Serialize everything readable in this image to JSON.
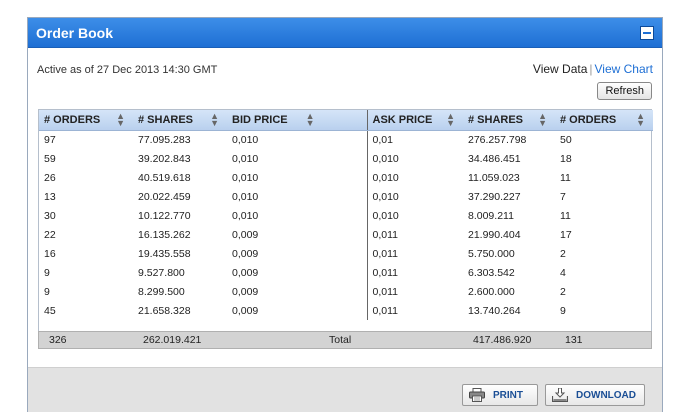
{
  "panel": {
    "title": "Order Book"
  },
  "status": "Active as of 27 Dec 2013 14:30 GMT",
  "view_links": {
    "data": "View Data",
    "separator": "|",
    "chart": "View Chart"
  },
  "refresh_label": "Refresh",
  "columns": [
    "# ORDERS",
    "# SHARES",
    "BID PRICE",
    "ASK PRICE",
    "# SHARES",
    "# ORDERS"
  ],
  "rows": [
    [
      "97",
      "77.095.283",
      "0,010",
      "0,01",
      "276.257.798",
      "50"
    ],
    [
      "59",
      "39.202.843",
      "0,010",
      "0,010",
      "34.486.451",
      "18"
    ],
    [
      "26",
      "40.519.618",
      "0,010",
      "0,010",
      "11.059.023",
      "11"
    ],
    [
      "13",
      "20.022.459",
      "0,010",
      "0,010",
      "37.290.227",
      "7"
    ],
    [
      "30",
      "10.122.770",
      "0,010",
      "0,010",
      "8.009.211",
      "11"
    ],
    [
      "22",
      "16.135.262",
      "0,009",
      "0,011",
      "21.990.404",
      "17"
    ],
    [
      "16",
      "19.435.558",
      "0,009",
      "0,011",
      "5.750.000",
      "2"
    ],
    [
      "9",
      "9.527.800",
      "0,009",
      "0,011",
      "6.303.542",
      "4"
    ],
    [
      "9",
      "8.299.500",
      "0,009",
      "0,011",
      "2.600.000",
      "2"
    ],
    [
      "45",
      "21.658.328",
      "0,009",
      "0,011",
      "13.740.264",
      "9"
    ]
  ],
  "totals": {
    "bid_orders": "326",
    "bid_shares": "262.019.421",
    "label": "Total",
    "ask_shares": "417.486.920",
    "ask_orders": "131"
  },
  "footer": {
    "print_label": "PRINT",
    "download_label": "DOWNLOAD"
  },
  "icons": {
    "collapse": "minus-square-icon",
    "sort": "sort-arrows-icon",
    "print": "printer-icon",
    "download": "download-tray-icon"
  },
  "colors": {
    "header_blue": "#1e6fd4",
    "link_blue": "#1e6fd4",
    "table_header": "#c7dbf3",
    "total_bg": "#d3d3d3"
  }
}
